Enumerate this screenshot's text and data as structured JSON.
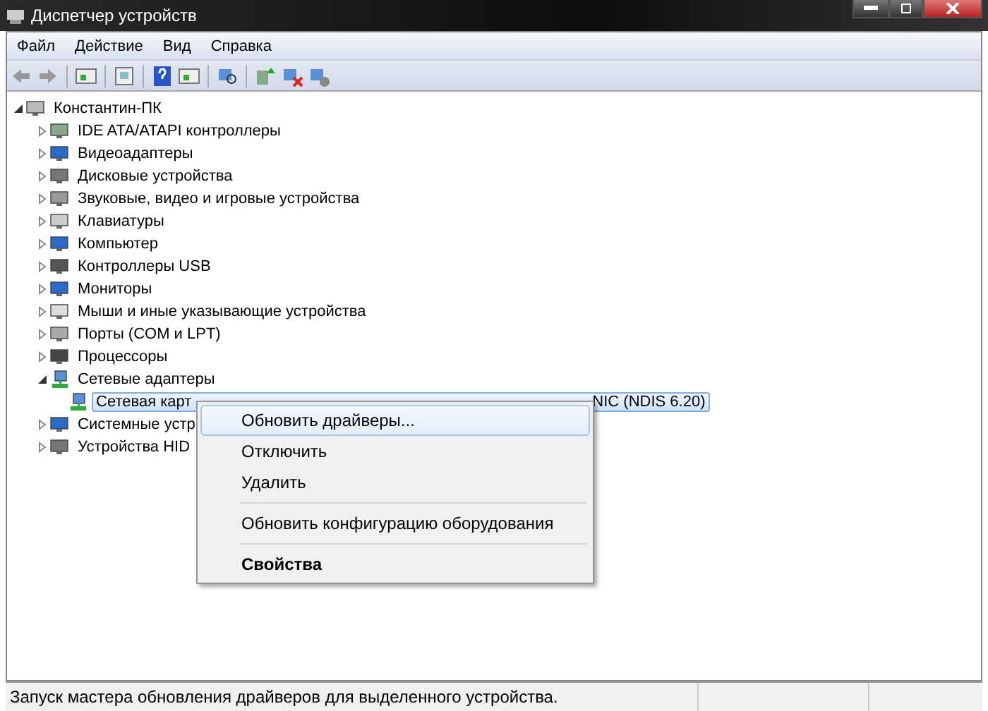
{
  "window": {
    "title": "Диспетчер устройств"
  },
  "menu_bar": [
    "Файл",
    "Действие",
    "Вид",
    "Справка"
  ],
  "tree": {
    "label": "Константин-ПК",
    "expanded": true,
    "children": [
      {
        "label": "IDE ATA/ATAPI контроллеры",
        "expanded": false
      },
      {
        "label": "Видеоадаптеры",
        "expanded": false
      },
      {
        "label": "Дисковые устройства",
        "expanded": false
      },
      {
        "label": "Звуковые, видео и игровые устройства",
        "expanded": false
      },
      {
        "label": "Клавиатуры",
        "expanded": false
      },
      {
        "label": "Компьютер",
        "expanded": false
      },
      {
        "label": "Контроллеры USB",
        "expanded": false
      },
      {
        "label": "Мониторы",
        "expanded": false
      },
      {
        "label": "Мыши и иные указывающие устройства",
        "expanded": false
      },
      {
        "label": "Порты (COM и LPT)",
        "expanded": false
      },
      {
        "label": "Процессоры",
        "expanded": false
      },
      {
        "label": "Сетевые адаптеры",
        "expanded": true,
        "children": [
          {
            "label": "Сетевая карт",
            "label_end": "NIC (NDIS 6.20)",
            "selected": true
          }
        ]
      },
      {
        "label": "Системные устр",
        "expanded": false
      },
      {
        "label": "Устройства HID",
        "expanded": false
      }
    ]
  },
  "context_menu": [
    {
      "kind": "item",
      "label": "Обновить драйверы...",
      "selected": true
    },
    {
      "kind": "item",
      "label": "Отключить",
      "selected": false
    },
    {
      "kind": "item",
      "label": "Удалить",
      "selected": false
    },
    {
      "kind": "separator"
    },
    {
      "kind": "item",
      "label": "Обновить конфигурацию оборудования",
      "selected": false
    },
    {
      "kind": "separator"
    },
    {
      "kind": "default",
      "label": "Свойства",
      "selected": false
    }
  ],
  "status_bar": "Запуск мастера обновления драйверов для выделенного устройства."
}
